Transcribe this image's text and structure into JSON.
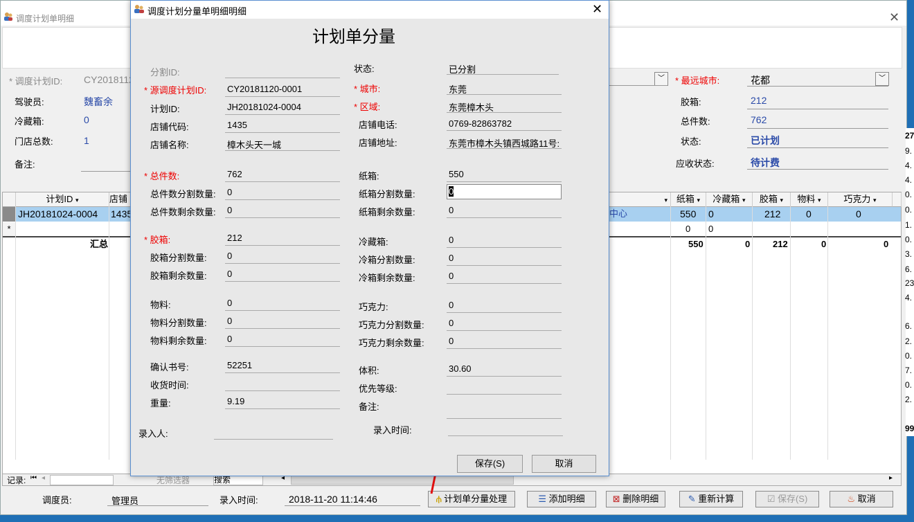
{
  "bg": {
    "title": "调度计划单明细",
    "plan_id_label": "* 调度计划ID:",
    "plan_id_value": "CY2018112",
    "driver_label": "驾驶员:",
    "driver_value": "魏畜余",
    "cold_label": "冷藏箱:",
    "cold_value": "0",
    "stores_label": "门店总数:",
    "stores_value": "1",
    "remark_label": "备注:",
    "nearest_city_label": "* 最远城市:",
    "nearest_city_value": "花都",
    "rubber_label": "胶箱:",
    "rubber_value": "212",
    "total_label": "总件数:",
    "total_value": "762",
    "status_label": "状态:",
    "status_value": "已计划",
    "recv_status_label": "应收状态:",
    "recv_status_value": "待计费"
  },
  "grid": {
    "left_headers": [
      "计划ID",
      "店铺"
    ],
    "right_headers": [
      "纸箱",
      "冷藏箱",
      "胶箱",
      "物料",
      "巧克力"
    ],
    "row1": {
      "plan_id": "JH20181024-0004",
      "store": "1435",
      "center": "中心",
      "carton": "550",
      "cold": "0",
      "rubber": "212",
      "material": "0",
      "choc": "0"
    },
    "new_row_marker": "*",
    "new_row": {
      "a": "0",
      "b": "0"
    },
    "sum_label": "汇总",
    "sum": {
      "carton": "550",
      "cold": "0",
      "rubber": "212",
      "material": "0",
      "choc": "0"
    },
    "nav_label": "记录:",
    "filter_label": "无筛选器",
    "search_label": "搜索"
  },
  "right_strip": [
    "27.",
    "9.",
    "4.",
    "4.",
    "0.",
    "0.",
    "1.",
    "0.",
    "3.",
    "6.",
    "23.",
    "4.",
    "6.",
    "2.",
    "0.",
    "7.",
    "0.",
    "2.",
    "99"
  ],
  "bottom": {
    "dispatcher_label": "调度员:",
    "dispatcher_value": "管理员",
    "entry_time_label": "录入时间:",
    "entry_time_value": "2018-11-20 11:14:46",
    "btn_split": "计划单分量处理",
    "btn_add": "添加明细",
    "btn_delete": "删除明细",
    "btn_recalc": "重新计算",
    "btn_save": "保存(S)",
    "btn_cancel": "取消"
  },
  "dialog": {
    "title": "调度计划分量单明细明细",
    "heading": "计划单分量",
    "split_id_label": "分割ID:",
    "src_plan_label": "* 源调度计划ID:",
    "src_plan_value": "CY20181120-0001",
    "plan_id_label": "计划ID:",
    "plan_id_value": "JH20181024-0004",
    "store_code_label": "店铺代码:",
    "store_code_value": "1435",
    "store_name_label": "店铺名称:",
    "store_name_value": "樟木头天一城",
    "status_label": "状态:",
    "status_value": "已分割",
    "city_label": "* 城市:",
    "city_value": "东莞",
    "area_label": "* 区域:",
    "area_value": "东莞樟木头",
    "phone_label": "店铺电话:",
    "phone_value": "0769-82863782",
    "address_label": "店铺地址:",
    "address_value": "东莞市樟木头镇西城路11号:",
    "total_label": "* 总件数:",
    "total_value": "762",
    "total_split_label": "总件数分割数量:",
    "total_split_value": "0",
    "total_rest_label": "总件数剩余数量:",
    "total_rest_value": "0",
    "carton_label": "纸箱:",
    "carton_value": "550",
    "carton_split_label": "纸箱分割数量:",
    "carton_split_value": "0",
    "carton_rest_label": "纸箱剩余数量:",
    "carton_rest_value": "0",
    "rubber_label": "* 胶箱:",
    "rubber_value": "212",
    "rubber_split_label": "胶箱分割数量:",
    "rubber_split_value": "0",
    "rubber_rest_label": "胶箱剩余数量:",
    "rubber_rest_value": "0",
    "cold_label": "冷藏箱:",
    "cold_value": "0",
    "cold_split_label": "冷箱分割数量:",
    "cold_split_value": "0",
    "cold_rest_label": "冷箱剩余数量:",
    "cold_rest_value": "0",
    "material_label": "物料:",
    "material_value": "0",
    "material_split_label": "物料分割数量:",
    "material_split_value": "0",
    "material_rest_label": "物料剩余数量:",
    "material_rest_value": "0",
    "choc_label": "巧克力:",
    "choc_value": "0",
    "choc_split_label": "巧克力分割数量:",
    "choc_split_value": "0",
    "choc_rest_label": "巧克力剩余数量:",
    "choc_rest_value": "0",
    "confirm_label": "确认书号:",
    "confirm_value": "52251",
    "recv_time_label": "收货时间:",
    "weight_label": "重量:",
    "weight_value": "9.19",
    "volume_label": "体积:",
    "volume_value": "30.60",
    "priority_label": "优先等级:",
    "remark_label": "备注:",
    "entry_person_label": "录入人:",
    "entry_time_label": "录入时间:",
    "save_btn": "保存(S)",
    "cancel_btn": "取消"
  }
}
